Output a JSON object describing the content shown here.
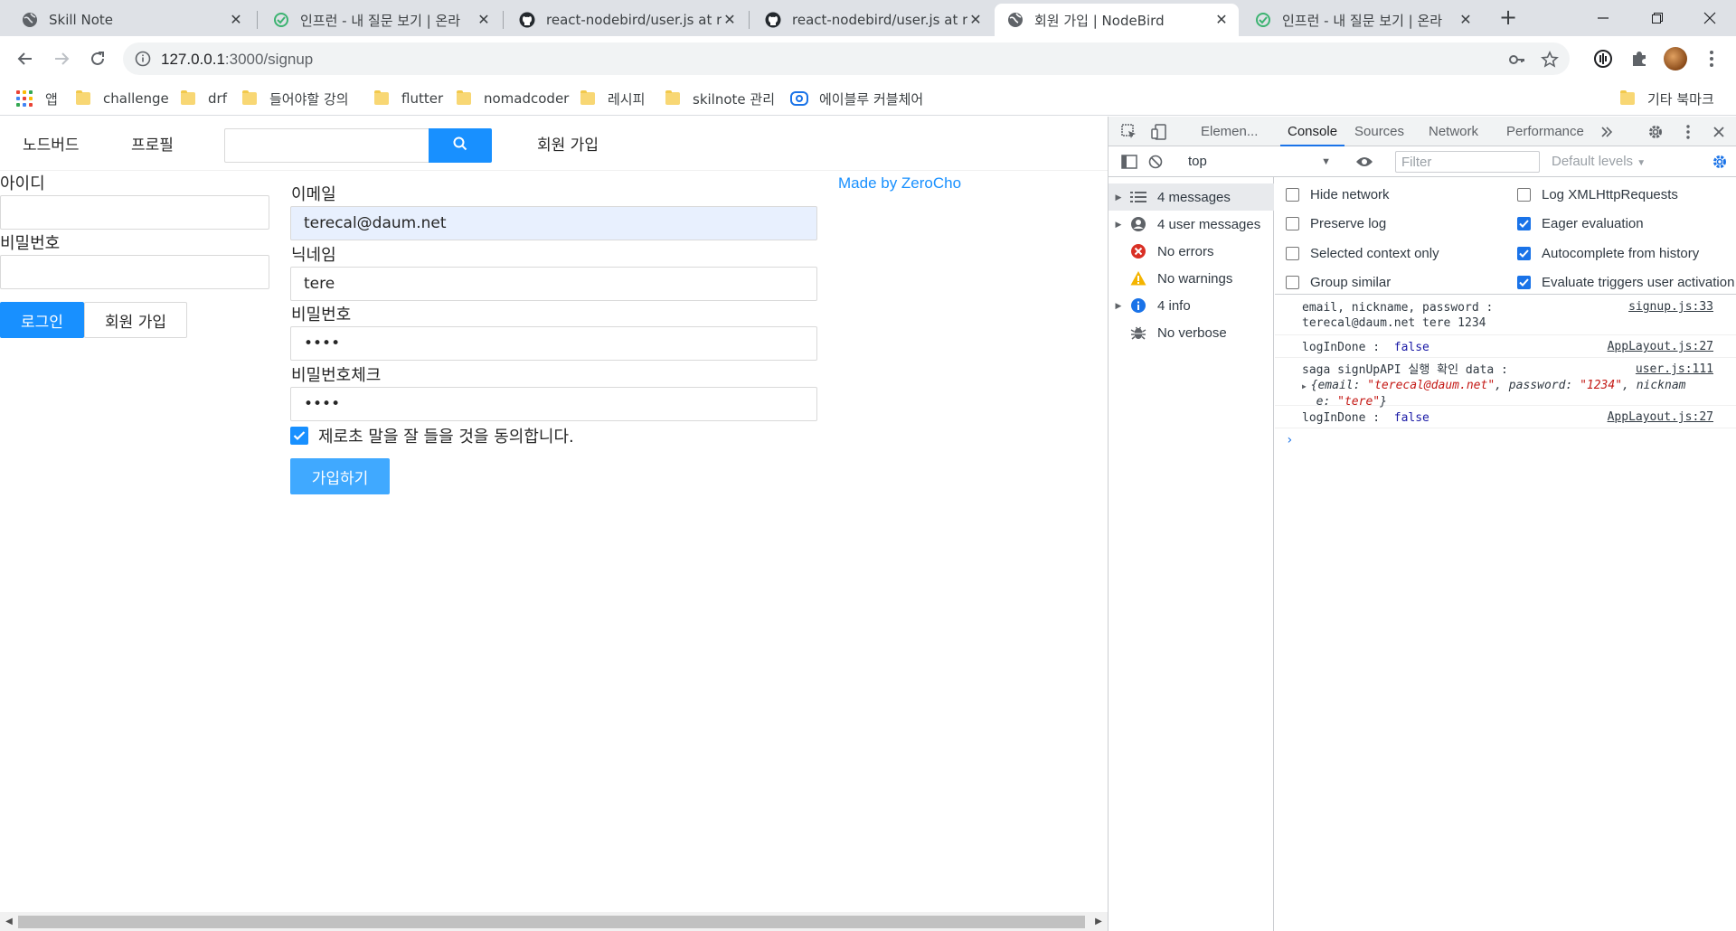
{
  "browser": {
    "tabs": [
      {
        "title": "Skill Note",
        "icon": "globe-icon",
        "active": false
      },
      {
        "title": "인프런 - 내 질문 보기 | 온라",
        "icon": "inflearn-icon",
        "active": false
      },
      {
        "title": "react-nodebird/user.js at re",
        "icon": "github-icon",
        "active": false
      },
      {
        "title": "react-nodebird/user.js at re",
        "icon": "github-icon",
        "active": false
      },
      {
        "title": "회원 가입 | NodeBird",
        "icon": "globe-icon",
        "active": true
      },
      {
        "title": "인프런 - 내 질문 보기 | 온라",
        "icon": "inflearn-icon",
        "active": false
      }
    ],
    "url_host": "127.0.0.1",
    "url_path": ":3000/signup",
    "bookmarks": [
      {
        "label": "앱",
        "icon": "apps-icon"
      },
      {
        "label": "challenge",
        "icon": "folder-icon"
      },
      {
        "label": "drf",
        "icon": "folder-icon"
      },
      {
        "label": "들어야할 강의",
        "icon": "folder-icon"
      },
      {
        "label": "flutter",
        "icon": "folder-icon"
      },
      {
        "label": "nomadcoder",
        "icon": "folder-icon"
      },
      {
        "label": "레시피",
        "icon": "folder-icon"
      },
      {
        "label": "skilnote 관리",
        "icon": "folder-icon"
      },
      {
        "label": "에이블루 커블체어",
        "icon": "ablue-icon"
      }
    ],
    "other_bookmarks": "기타 북마크"
  },
  "app": {
    "menu": {
      "home": "노드버드",
      "profile": "프로필",
      "search_value": "",
      "signup": "회원 가입"
    },
    "login_form": {
      "id_label": "아이디",
      "id_value": "",
      "password_label": "비밀번호",
      "password_value": "",
      "login_button": "로그인",
      "signup_button": "회원 가입"
    },
    "signup_form": {
      "email_label": "이메일",
      "email_value": "terecal@daum.net",
      "nickname_label": "닉네임",
      "nickname_value": "tere",
      "password_label": "비밀번호",
      "password_value": "••••",
      "password_check_label": "비밀번호체크",
      "password_check_value": "••••",
      "terms_label": "제로초 말을 잘 들을 것을 동의합니다.",
      "terms_checked": true,
      "submit_button": "가입하기"
    },
    "made_by": "Made by ZeroCho"
  },
  "devtools": {
    "tabs": [
      "Elemen...",
      "Console",
      "Sources",
      "Network",
      "Performance"
    ],
    "active_tab": "Console",
    "context": "top",
    "filter_placeholder": "Filter",
    "levels": "Default levels",
    "sidebar": [
      {
        "label": "4 messages",
        "icon": "list-icon",
        "expandable": true,
        "selected": true
      },
      {
        "label": "4 user messages",
        "icon": "user-icon",
        "expandable": true,
        "selected": false
      },
      {
        "label": "No errors",
        "icon": "error-icon",
        "expandable": false,
        "selected": false
      },
      {
        "label": "No warnings",
        "icon": "warning-icon",
        "expandable": false,
        "selected": false
      },
      {
        "label": "4 info",
        "icon": "info-icon",
        "expandable": true,
        "selected": false
      },
      {
        "label": "No verbose",
        "icon": "bug-icon",
        "expandable": false,
        "selected": false
      }
    ],
    "settings": [
      {
        "label": "Hide network",
        "checked": false
      },
      {
        "label": "Log XMLHttpRequests",
        "checked": false
      },
      {
        "label": "Preserve log",
        "checked": false
      },
      {
        "label": "Eager evaluation",
        "checked": true
      },
      {
        "label": "Selected context only",
        "checked": false
      },
      {
        "label": "Autocomplete from history",
        "checked": true
      },
      {
        "label": "Group similar",
        "checked": false
      },
      {
        "label": "Evaluate triggers user activation",
        "checked": true
      }
    ],
    "messages": [
      {
        "line1": "email, nickname, password :",
        "line2": "terecal@daum.net tere 1234",
        "source": "signup.js:33"
      },
      {
        "text": "logInDone :",
        "value": "false",
        "source": "AppLayout.js:27"
      },
      {
        "text": "saga signUpAPI 실행 확인 data :",
        "source": "user.js:111",
        "obj_open": "{email: ",
        "email": "\"terecal@daum.net\"",
        "obj_mid": ", password: ",
        "password": "\"1234\"",
        "obj_end1": ", nicknam",
        "obj_line2_pre": "e: ",
        "nickname": "\"tere\"",
        "obj_close": "}"
      },
      {
        "text": "logInDone :",
        "value": "false",
        "source": "AppLayout.js:27"
      }
    ]
  }
}
